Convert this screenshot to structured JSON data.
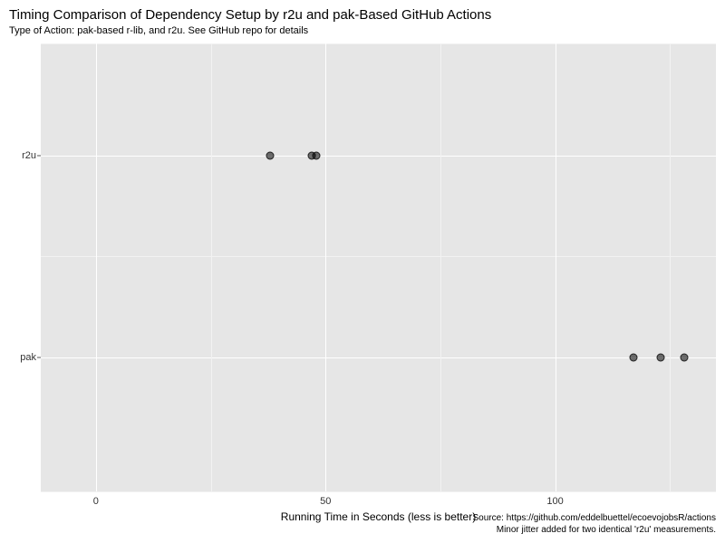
{
  "chart_data": {
    "type": "scatter",
    "title": "Timing Comparison of Dependency Setup by r2u and pak-Based GitHub Actions",
    "subtitle": "Type of Action: pak-based r-lib, and r2u. See GitHub repo for details",
    "xlabel": "Running Time in Seconds (less is better)",
    "ylabel": "",
    "xlim": [
      -12,
      135
    ],
    "x_ticks": [
      0,
      50,
      100
    ],
    "categories": [
      "r2u",
      "pak"
    ],
    "series": [
      {
        "name": "r2u",
        "values": [
          38,
          47,
          48
        ]
      },
      {
        "name": "pak",
        "values": [
          117,
          123,
          128
        ]
      }
    ],
    "caption_line1": "Source: https://github.com/eddelbuettel/ecoevojobsR/actions",
    "caption_line2": "Minor jitter added for two identical 'r2u' measurements.",
    "point_color": "rgba(0,0,0,0.55)",
    "grid_major_color": "#ffffff",
    "panel_bg": "#e6e6e6"
  }
}
